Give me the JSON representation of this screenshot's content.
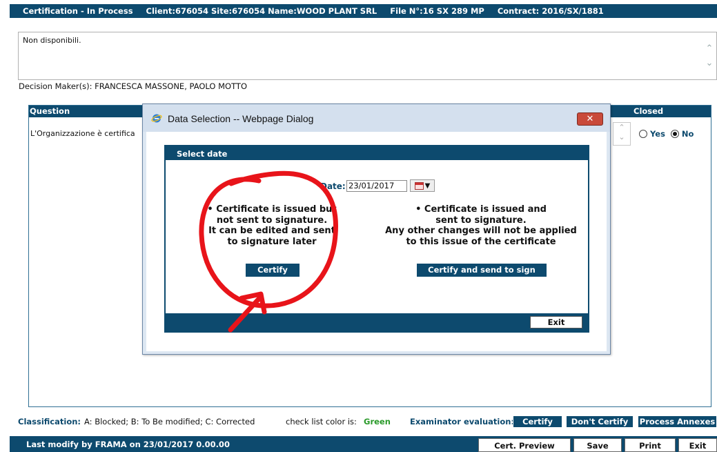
{
  "header": {
    "status": "Certification - In Process",
    "client": "Client:676054",
    "site": "Site:676054",
    "name": "Name:WOOD PLANT SRL",
    "file": "File N°:16 SX 289 MP",
    "contract": "Contract: 2016/SX/1881"
  },
  "notes": {
    "value": "Non disponibili."
  },
  "decision_makers": "Decision Maker(s): FRANCESCA MASSONE, PAOLO MOTTO",
  "question_panel": {
    "col_question": "Question",
    "col_closed": "Closed",
    "question_text": "L'Organizzazione è certifica",
    "yes_label": "Yes",
    "no_label": "No",
    "selected": "No"
  },
  "classification": {
    "label": "Classification:",
    "legend": "A: Blocked;  B: To Be modified;  C: Corrected",
    "checklist_label": "check list color is:",
    "checklist_color": "Green",
    "examinator_label": "Examinator evaluation:",
    "certify": "Certify",
    "dont_certify": "Don't Certify",
    "process_annexes": "Process Annexes"
  },
  "footer": {
    "last_modify": "Last modify by FRAMA on 23/01/2017 0.00.00",
    "cert_preview": "Cert. Preview",
    "save": "Save",
    "print": "Print",
    "exit": "Exit"
  },
  "dialog": {
    "title": "Data Selection -- Webpage Dialog",
    "close_glyph": "✕",
    "section_title": "Select date",
    "date_label": "Date:",
    "date_value": "23/01/2017",
    "left_text": [
      "•  Certificate is issued but",
      "not sent to signature.",
      "It can be edited and sent",
      "to signature later"
    ],
    "right_text": [
      "•  Certificate is issued and",
      "sent to signature.",
      "Any other changes will not be applied",
      "to this issue of the certificate"
    ],
    "certify_button": "Certify",
    "certify_sign_button": "Certify and send to sign",
    "exit_button": "Exit"
  },
  "colors": {
    "primary": "#0d4a6e",
    "green": "#2a9a2a",
    "annotation": "#e8141a",
    "dialog_bg": "#dde7f2"
  }
}
